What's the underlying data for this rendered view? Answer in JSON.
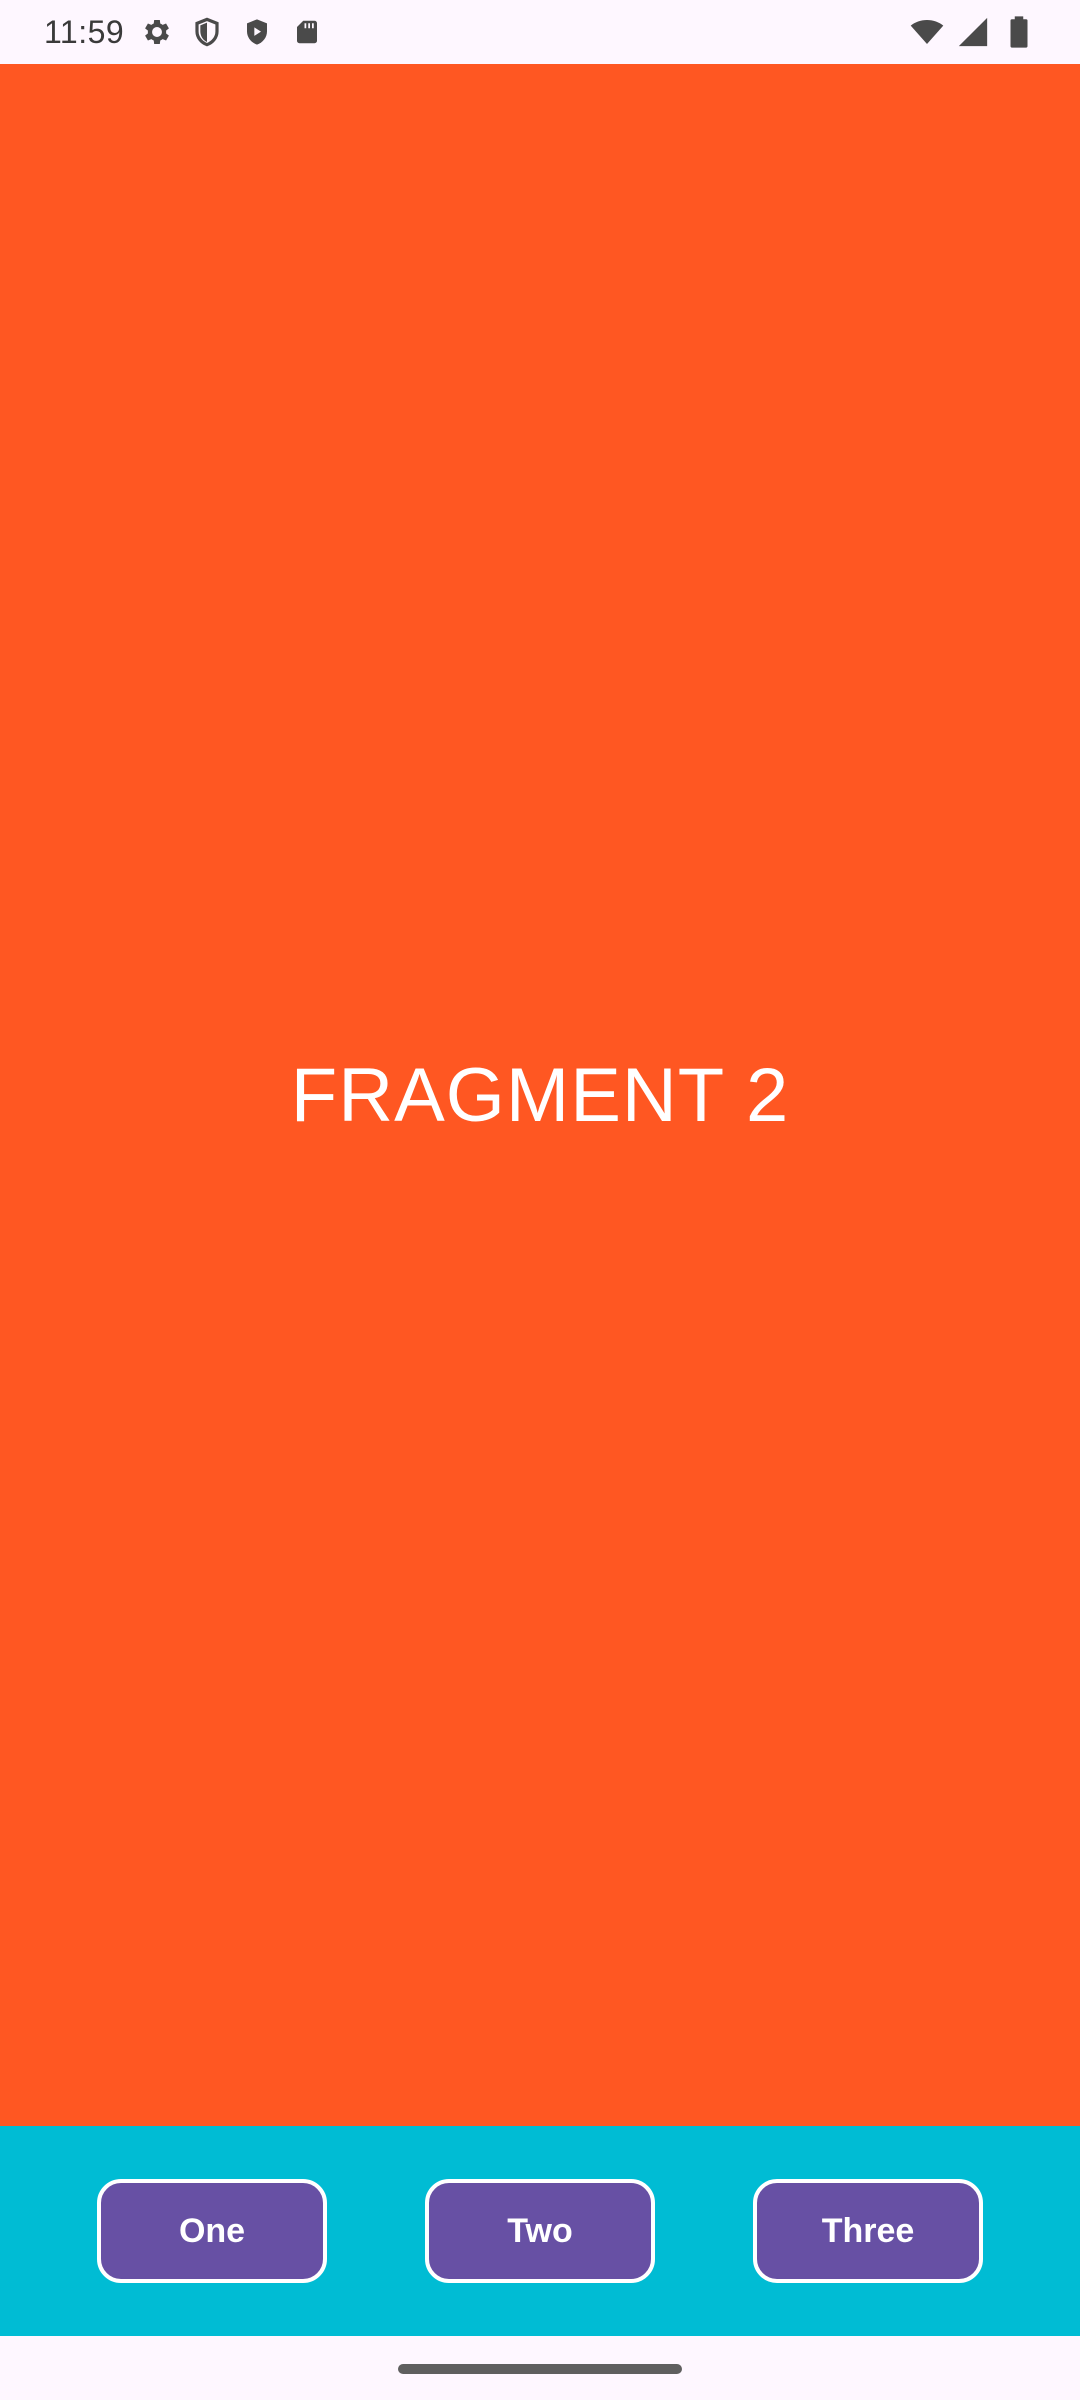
{
  "status_bar": {
    "time": "11:59",
    "left_icons": [
      "gear-icon",
      "shield-outline-icon",
      "shield-play-icon",
      "sd-card-icon"
    ],
    "right_icons": [
      "wifi-icon",
      "cell-signal-icon",
      "battery-icon"
    ]
  },
  "fragment": {
    "title": "FRAGMENT 2",
    "background": "#FF5722"
  },
  "buttons": {
    "one": "One",
    "two": "Two",
    "three": "Three"
  },
  "colors": {
    "bottom_bar": "#00BCD4",
    "button_fill": "#6750A4",
    "button_border": "#FFFFFF"
  }
}
